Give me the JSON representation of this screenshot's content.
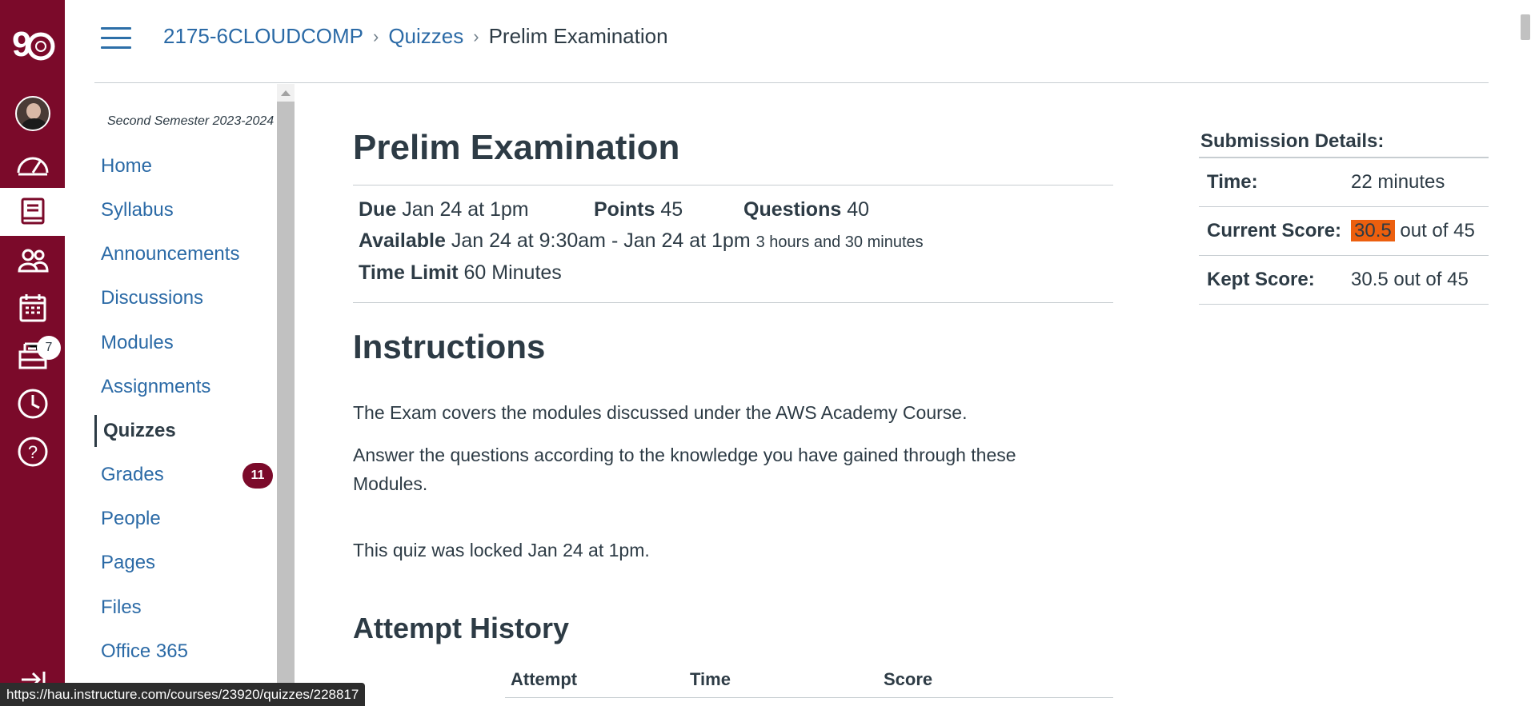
{
  "breadcrumb": {
    "course": "2175-6CLOUDCOMP",
    "section": "Quizzes",
    "current": "Prelim Examination"
  },
  "global_nav": {
    "logo": "90-logo",
    "inbox_badge": "7"
  },
  "course_nav": {
    "term": "Second Semester 2023-2024",
    "items": [
      {
        "label": "Home"
      },
      {
        "label": "Syllabus"
      },
      {
        "label": "Announcements"
      },
      {
        "label": "Discussions"
      },
      {
        "label": "Modules"
      },
      {
        "label": "Assignments"
      },
      {
        "label": "Quizzes"
      },
      {
        "label": "Grades",
        "badge": "11"
      },
      {
        "label": "People"
      },
      {
        "label": "Pages"
      },
      {
        "label": "Files"
      },
      {
        "label": "Office 365"
      }
    ]
  },
  "quiz": {
    "title": "Prelim Examination",
    "due_label": "Due",
    "due_value": "Jan 24 at 1pm",
    "points_label": "Points",
    "points_value": "45",
    "questions_label": "Questions",
    "questions_value": "40",
    "available_label": "Available",
    "available_value": "Jan 24 at 9:30am - Jan 24 at 1pm",
    "available_duration": "3 hours and 30 minutes",
    "time_limit_label": "Time Limit",
    "time_limit_value": "60 Minutes",
    "instructions_heading": "Instructions",
    "instructions_p1": "The Exam covers the modules discussed under the AWS Academy Course.",
    "instructions_p2": "Answer the questions according to the knowledge you have gained through these Modules.",
    "locked_note": "This quiz was locked Jan 24 at 1pm.",
    "attempt_heading": "Attempt History",
    "attempt_columns": [
      "Attempt",
      "Time",
      "Score"
    ]
  },
  "submission": {
    "heading": "Submission Details:",
    "time_label": "Time:",
    "time_value": "22 minutes",
    "current_label": "Current Score:",
    "current_score": "30.5",
    "current_suffix": " out of 45",
    "kept_label": "Kept Score:",
    "kept_value": "30.5 out of 45"
  },
  "status_url": "https://hau.instructure.com/courses/23920/quizzes/228817",
  "colors": {
    "brand": "#7b0a2a",
    "link": "#2b6aa6",
    "highlight": "#ec5f0e"
  }
}
